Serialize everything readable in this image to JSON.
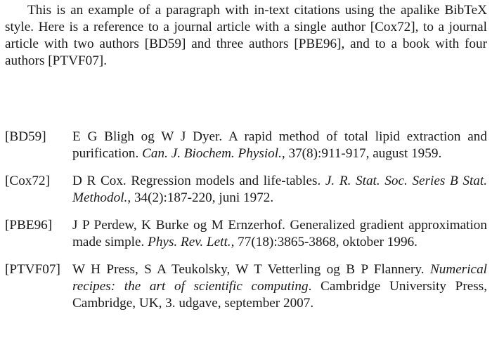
{
  "intro": {
    "text_1": "This is an example of a paragraph with in-text citations using the apalike BibTeX style. Here is a reference to a journal article with a single author ",
    "cite_cox": "[Cox72]",
    "text_2": ", to a journal article with two authors ",
    "cite_bd": "[BD59]",
    "text_3": " and three authors ",
    "cite_pbe": "[PBE96]",
    "text_4": ", and to a book with four authors ",
    "cite_ptvf": "[PTVF07]",
    "text_5": "."
  },
  "bibliography": [
    {
      "label": "[BD59]",
      "authors": "E G Bligh og W J Dyer. ",
      "title": "A rapid method of total lipid extraction and purification. ",
      "venue": "Can. J. Biochem. Physiol.",
      "details": ", 37(8):911-917, august 1959."
    },
    {
      "label": "[Cox72]",
      "authors": "D R Cox. ",
      "title": "Regression models and life-tables. ",
      "venue": "J. R. Stat. Soc. Series B Stat. Methodol.",
      "details": ", 34(2):187-220, juni 1972."
    },
    {
      "label": "[PBE96]",
      "authors": "J P Perdew, K Burke og M Ernzerhof. ",
      "title": "Generalized gradient approximation made simple. ",
      "venue": "Phys. Rev. Lett.",
      "details": ", 77(18):3865-3868, oktober 1996."
    },
    {
      "label": "[PTVF07]",
      "authors": "W H Press, S A Teukolsky, W T Vetterling og B P Flannery. ",
      "title": "Numerical recipes: the art of scientific computing",
      "details": ". Cambridge University Press, Cambridge, UK, 3. udgave, september 2007."
    }
  ]
}
